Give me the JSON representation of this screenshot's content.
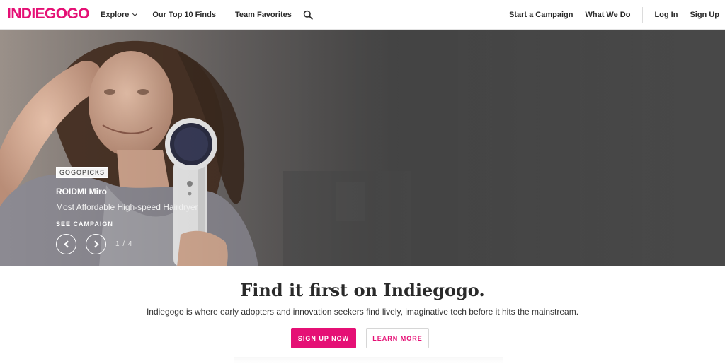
{
  "header": {
    "logo": "INDIEGOGO",
    "nav_left": [
      "Explore",
      "Our Top 10 Finds",
      "Team Favorites"
    ],
    "nav_right": [
      "Start a Campaign",
      "What We Do",
      "Log In",
      "Sign Up"
    ]
  },
  "hero": {
    "badge": "GOGOPICKS",
    "title": "ROIDMI Miro",
    "subtitle": "Most Affordable High-speed Hairdryer",
    "cta": "SEE CAMPAIGN",
    "counter": "1 / 4"
  },
  "promo": {
    "title": "Find it first on Indiegogo.",
    "text": "Indiegogo is where early adopters and innovation seekers find lively, imaginative tech before it hits the mainstream.",
    "primary_button": "SIGN UP NOW",
    "secondary_button": "LEARN MORE"
  },
  "colors": {
    "brand": "#e51075",
    "hero_bg": "#4b4b4b"
  },
  "icons": {
    "search": "search-icon",
    "explore_chevron": "chevron-down-icon",
    "prev": "chevron-left-icon",
    "next": "chevron-right-icon"
  }
}
